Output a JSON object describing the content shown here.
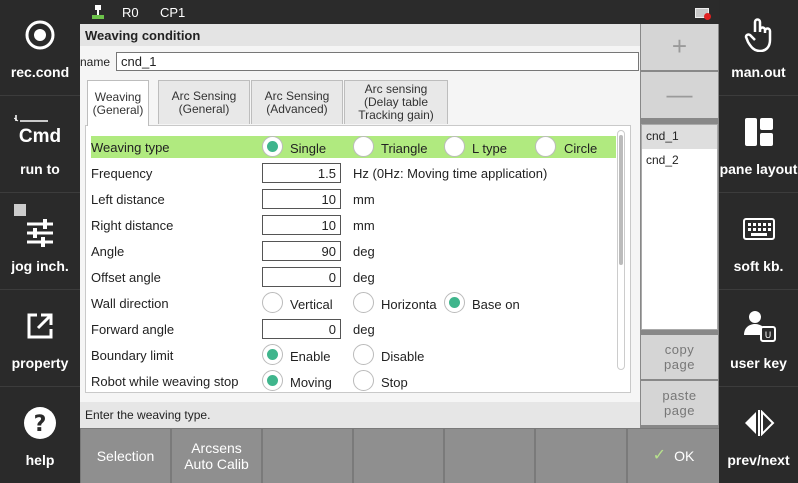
{
  "topbar": {
    "robot": "R0",
    "program": "CP1",
    "icons": [
      "robot-icon",
      "flag-icon"
    ]
  },
  "left_sidebar": [
    {
      "label": "rec.cond",
      "icon": "record-icon"
    },
    {
      "label": "run to",
      "icon_text": "Cmd",
      "icon": "cmd-icon"
    },
    {
      "label": "jog inch.",
      "icon": "sliders-icon"
    },
    {
      "label": "property",
      "icon": "external-link-icon"
    },
    {
      "label": "help",
      "icon": "help-icon"
    }
  ],
  "right_sidebar": [
    {
      "label": "man.out",
      "icon": "hand-pointer-icon"
    },
    {
      "label": "pane layout",
      "icon": "layout-icon"
    },
    {
      "label": "soft kb.",
      "icon": "keyboard-icon"
    },
    {
      "label": "user key",
      "icon": "user-key-icon"
    },
    {
      "label": "prev/next",
      "icon": "prev-next-icon"
    }
  ],
  "dialog": {
    "title": "Weaving condition",
    "name_label": "name",
    "name_value": "cnd_1",
    "tabs": [
      {
        "label": "Weaving\n(General)",
        "active": true
      },
      {
        "label": "Arc Sensing\n(General)",
        "active": false
      },
      {
        "label": "Arc Sensing\n(Advanced)",
        "active": false
      },
      {
        "label": "Arc sensing\n(Delay table\nTracking gain)",
        "active": false
      }
    ],
    "weaving_type": {
      "label": "Weaving type",
      "options": [
        "Single",
        "Triangle",
        "L type",
        "Circle"
      ],
      "selected": "Single"
    },
    "fields": [
      {
        "label": "Frequency",
        "value": "1.5",
        "unit": "Hz (0Hz: Moving time application)"
      },
      {
        "label": "Left distance",
        "value": "10",
        "unit": "mm"
      },
      {
        "label": "Right distance",
        "value": "10",
        "unit": "mm"
      },
      {
        "label": "Angle",
        "value": "90",
        "unit": "deg"
      },
      {
        "label": "Offset angle",
        "value": "0",
        "unit": "deg"
      }
    ],
    "wall_direction": {
      "label": "Wall direction",
      "options": [
        "Vertical",
        "Horizonta",
        "Base on"
      ],
      "selected": "Base on"
    },
    "forward_angle": {
      "label": "Forward angle",
      "value": "0",
      "unit": "deg"
    },
    "boundary_limit": {
      "label": "Boundary limit",
      "options": [
        "Enable",
        "Disable"
      ],
      "selected": "Enable"
    },
    "robot_while_weaving_stop": {
      "label": "Robot while weaving stop",
      "options": [
        "Moving",
        "Stop"
      ],
      "selected": "Moving"
    },
    "status_text": "Enter the weaving type."
  },
  "list_panel": {
    "plus_label": "+",
    "minus_label": "—",
    "items": [
      "cnd_1",
      "cnd_2"
    ],
    "selected": "cnd_1",
    "copy_label": "copy\npage",
    "paste_label": "paste\npage"
  },
  "bottom_bar": {
    "keys": [
      "Selection",
      "Arcsens\nAuto Calib",
      "",
      "",
      "",
      "",
      "OK"
    ]
  },
  "colors": {
    "highlight_row": "#b0ea7f",
    "radio_selected": "#3fb58c",
    "sidebar_bg": "#2a2a2a"
  }
}
